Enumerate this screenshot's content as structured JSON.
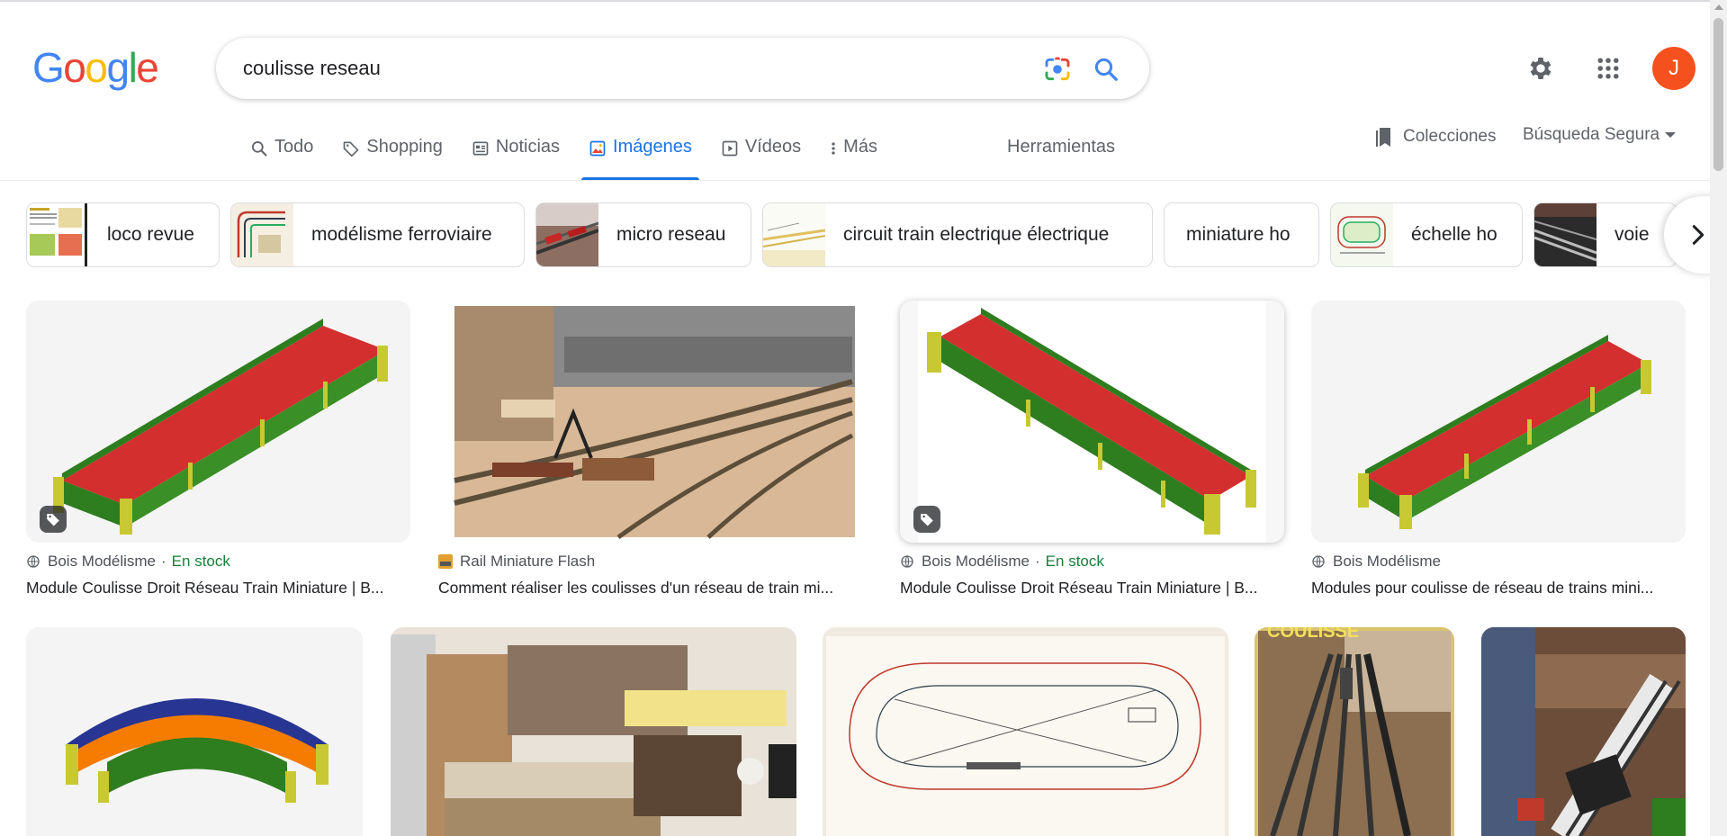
{
  "logo": [
    "G",
    "o",
    "o",
    "g",
    "l",
    "e"
  ],
  "logo_colors": [
    "#4285F4",
    "#EA4335",
    "#FBBC05",
    "#4285F4",
    "#34A853",
    "#EA4335"
  ],
  "search": {
    "query": "coulisse reseau"
  },
  "user": {
    "initial": "J",
    "avatar_color": "#f4511e"
  },
  "tabs": [
    {
      "label": "Todo",
      "icon": "search-icon"
    },
    {
      "label": "Shopping",
      "icon": "tag-icon"
    },
    {
      "label": "Noticias",
      "icon": "news-icon"
    },
    {
      "label": "Imágenes",
      "icon": "image-icon",
      "active": true
    },
    {
      "label": "Vídeos",
      "icon": "play-icon"
    },
    {
      "label": "Más",
      "icon": "more-vert-icon"
    }
  ],
  "tools_label": "Herramientas",
  "collections_label": "Colecciones",
  "safesearch_label": "Búsqueda Segura",
  "chips": [
    {
      "label": "loco revue"
    },
    {
      "label": "modélisme ferroviaire"
    },
    {
      "label": "micro reseau"
    },
    {
      "label": "circuit train electrique électrique"
    },
    {
      "label": "miniature ho"
    },
    {
      "label": "échelle ho"
    },
    {
      "label": "voie"
    }
  ],
  "results": [
    {
      "source": "Bois Modélisme",
      "stock": "En stock",
      "title": "Module Coulisse Droit Réseau Train Miniature | B..."
    },
    {
      "source": "Rail Miniature Flash",
      "title": "Comment réaliser les coulisses d'un réseau de train mi..."
    },
    {
      "source": "Bois Modélisme",
      "stock": "En stock",
      "title": "Module Coulisse Droit Réseau Train Miniature | B..."
    },
    {
      "source": "Bois Modélisme",
      "title": "Modules pour coulisse de réseau de trains mini..."
    }
  ],
  "row2_labels": {
    "coulisse_caption": "COULISSE"
  },
  "colors": {
    "accent": "#1a73e8",
    "stock": "#188038",
    "module_red": "#d32f2f",
    "module_green": "#2e7d1f",
    "module_yellow": "#c8c832",
    "module_orange": "#f57c00",
    "module_blue": "#283593"
  }
}
